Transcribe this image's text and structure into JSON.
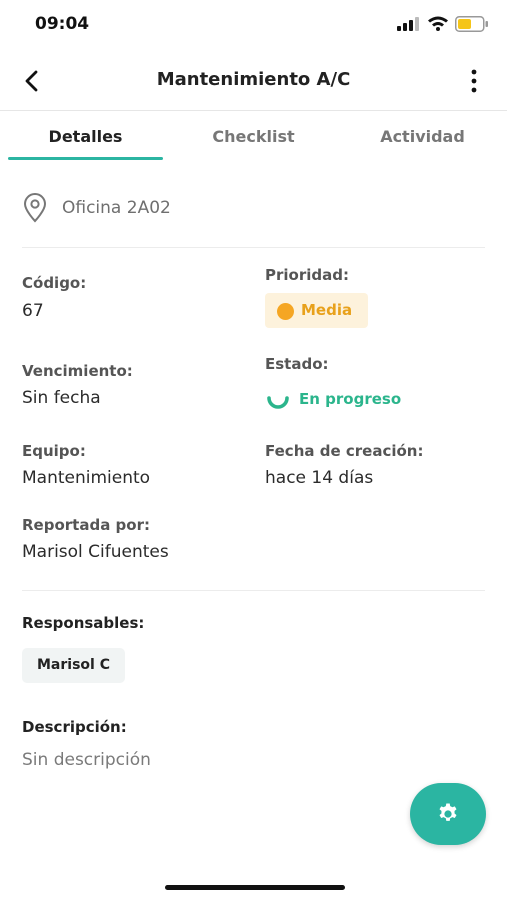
{
  "status_bar": {
    "time": "09:04",
    "icons": [
      "signal-icon",
      "wifi-icon",
      "battery-icon"
    ],
    "battery_color": "#f5c518"
  },
  "header": {
    "title": "Mantenimiento A/C",
    "back_icon": "chevron-left-icon",
    "menu_icon": "more-vertical-icon"
  },
  "tabs": [
    {
      "label": "Detalles",
      "active": true
    },
    {
      "label": "Checklist",
      "active": false
    },
    {
      "label": "Actividad",
      "active": false
    }
  ],
  "location": {
    "icon": "map-pin-icon",
    "text": "Oficina 2A02"
  },
  "details": {
    "codigo": {
      "label": "Código:",
      "value": "67"
    },
    "prioridad": {
      "label": "Prioridad:",
      "value": "Media",
      "color": "#f5a623"
    },
    "vencimiento": {
      "label": "Vencimiento:",
      "value": "Sin fecha"
    },
    "estado": {
      "label": "Estado:",
      "value": "En progreso",
      "color": "#2bb58c"
    },
    "equipo": {
      "label": "Equipo:",
      "value": "Mantenimiento"
    },
    "fecha_creacion": {
      "label": "Fecha de creación:",
      "value": "hace 14 días"
    },
    "reportada_por": {
      "label": "Reportada por:",
      "value": "Marisol Cifuentes"
    }
  },
  "responsables": {
    "label": "Responsables:",
    "items": [
      "Marisol C"
    ]
  },
  "descripcion": {
    "label": "Descripción:",
    "value": "Sin descripción"
  },
  "fab": {
    "icon": "gear-icon",
    "color": "#2bb5a2"
  },
  "colors": {
    "accent": "#2bb5a2"
  }
}
